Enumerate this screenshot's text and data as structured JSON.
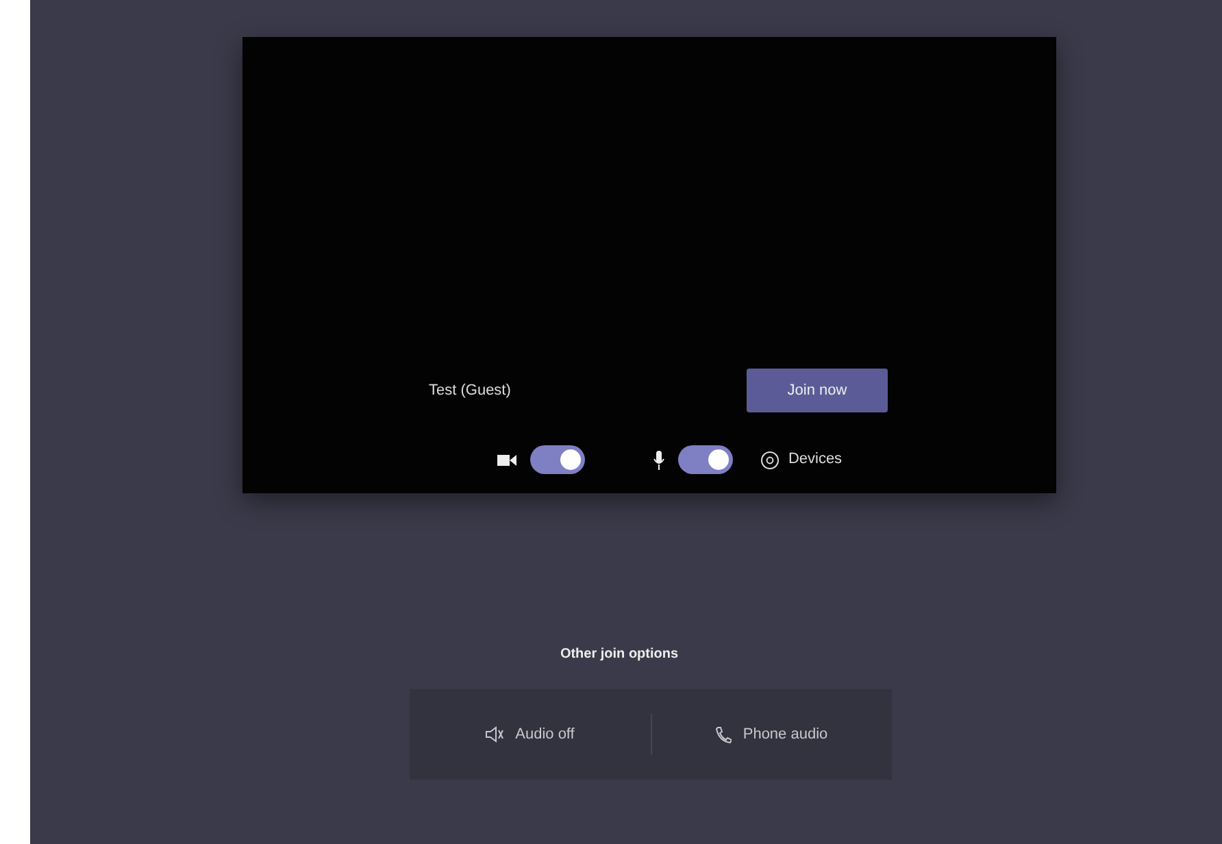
{
  "preview": {
    "name": "Test (Guest)",
    "join_button": "Join now",
    "toggles": [
      {
        "kind": "camera",
        "on": true
      },
      {
        "kind": "microphone",
        "on": true
      }
    ],
    "devices": "Devices"
  },
  "other_join_options": {
    "title": "Other join options",
    "options": [
      {
        "kind": "audio-off",
        "label": "Audio off"
      },
      {
        "kind": "phone",
        "label": "Phone audio"
      }
    ]
  }
}
